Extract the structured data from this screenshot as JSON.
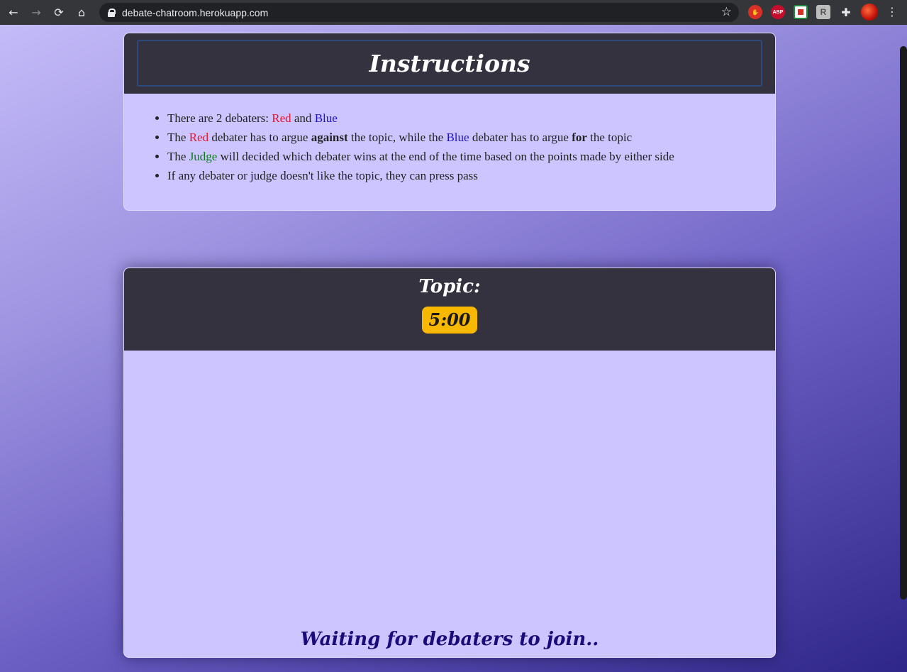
{
  "browser": {
    "url": "debate-chatroom.herokuapp.com",
    "back_icon": "←",
    "forward_icon": "→",
    "reload_icon": "⟳",
    "home_icon": "⌂",
    "star_icon": "☆",
    "puzzle_icon": "✚",
    "menu_icon": "⋮",
    "abp_label": "ABP",
    "ext_r_label": "R"
  },
  "instructions": {
    "title": "Instructions",
    "rules": [
      [
        "There are 2 debaters: ",
        "Red",
        " and ",
        "Blue"
      ],
      [
        "The ",
        "Red",
        " debater has to argue ",
        "against",
        " the topic, while the ",
        "Blue",
        " debater has to argue ",
        "for",
        " the topic"
      ],
      [
        "The ",
        "Judge",
        " will decided which debater wins at the end of the time based on the points made by either side"
      ],
      [
        "If any debater or judge doesn't like the topic, they can press pass"
      ]
    ]
  },
  "debate": {
    "topic_label": "Topic:",
    "timer": "5:00",
    "waiting_text": "Waiting for debaters to join.."
  },
  "colors": {
    "red": "#e8132b",
    "blue": "#1e14c8",
    "judge": "#0f7a1c",
    "timer_bg": "#f9b800",
    "header_bg": "#34323f",
    "card_bg": "#ccc5ff"
  }
}
